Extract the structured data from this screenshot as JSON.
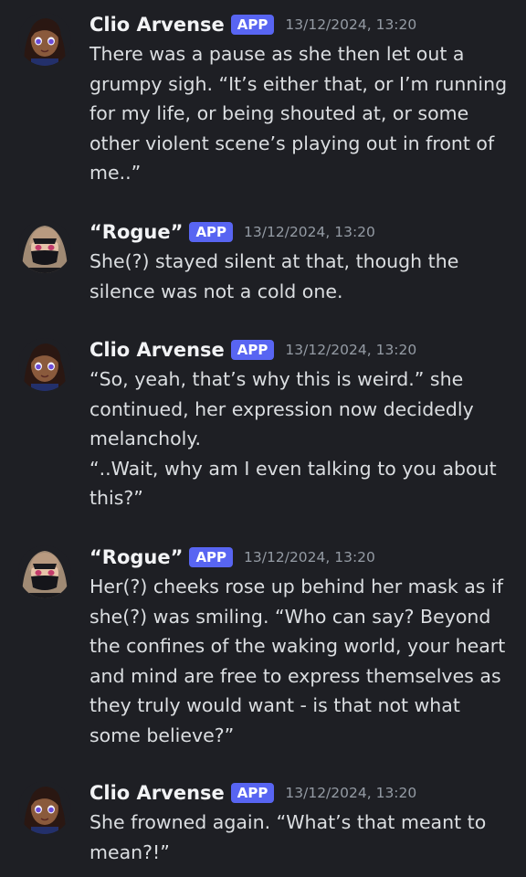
{
  "messages": [
    {
      "author": "Clio Arvense",
      "badge": "APP",
      "timestamp": "13/12/2024, 13:20",
      "text": "There was a pause as she then let out a\ngrumpy sigh. “It’s either that, or I’m running\nfor my life, or being shouted at, or some\nother violent scene’s playing out in front of\nme..”"
    },
    {
      "author": "“Rogue”",
      "badge": "APP",
      "timestamp": "13/12/2024, 13:20",
      "text": "She(?) stayed silent at that, though the\nsilence was not a cold one."
    },
    {
      "author": "Clio Arvense",
      "badge": "APP",
      "timestamp": "13/12/2024, 13:20",
      "text": "“So, yeah, that’s why this is weird.” she\ncontinued, her expression now decidedly\nmelancholy.\n“..Wait, why am I even talking to you about\nthis?”"
    },
    {
      "author": "“Rogue”",
      "badge": "APP",
      "timestamp": "13/12/2024, 13:20",
      "text": "Her(?) cheeks rose up behind her mask as if\nshe(?) was smiling. “Who can say? Beyond\nthe confines of the waking world, your heart\nand mind are free to express themselves as\nthey truly would want - is that not what\nsome believe?”"
    },
    {
      "author": "Clio Arvense",
      "badge": "APP",
      "timestamp": "13/12/2024, 13:20",
      "text": "She frowned again. “What’s that meant to\nmean?!”"
    }
  ],
  "colors": {
    "background": "#1e1f24",
    "badge": "#5865f2",
    "username": "#f2f3f5",
    "message_text": "#dbdee1",
    "timestamp": "#949ba4"
  },
  "avatars": {
    "clio": "clio-arvense-avatar",
    "rogue": "rogue-masked-avatar"
  }
}
